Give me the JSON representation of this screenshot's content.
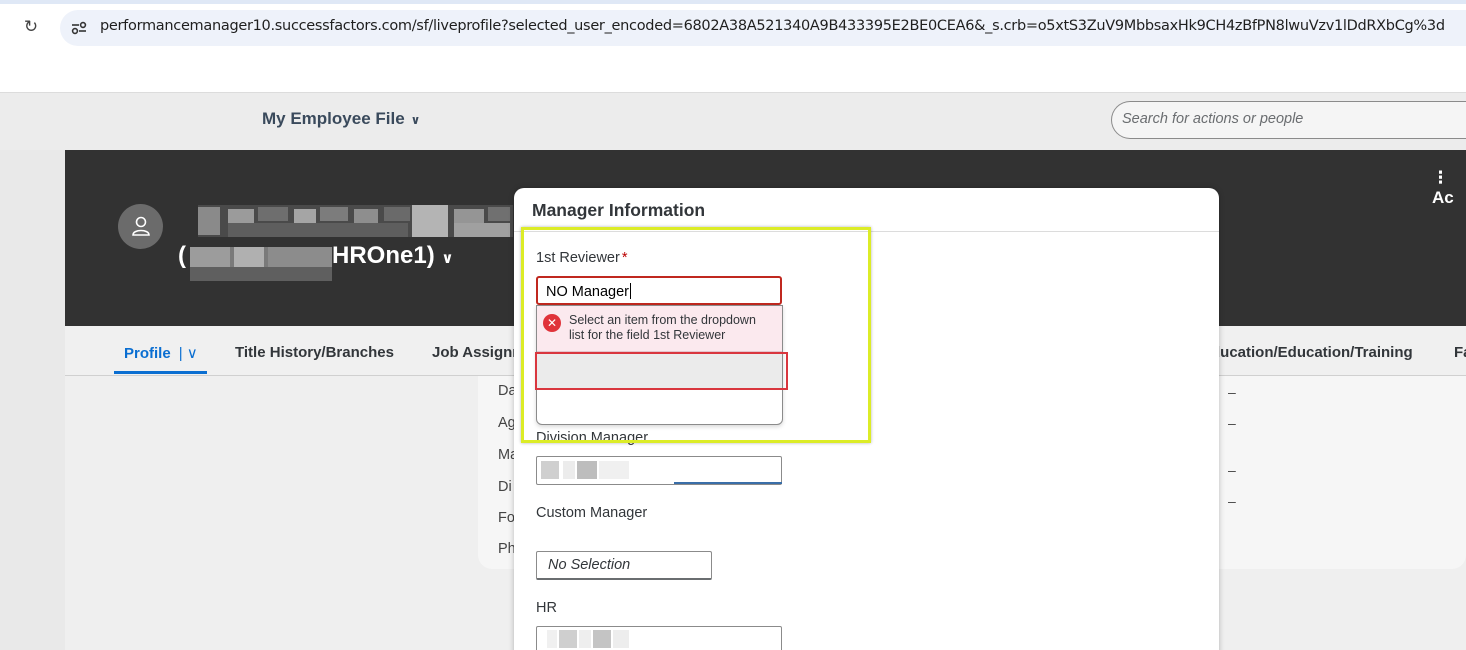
{
  "browser": {
    "url": "performancemanager10.successfactors.com/sf/liveprofile?selected_user_encoded=6802A38A521340A9B433395E2BE0CEA6&_s.crb=o5xtS3ZuV9MbbsaxHk9CH4zBfPN8lwuVzv1lDdRXbCg%3d"
  },
  "shell": {
    "home_title": "My Employee File",
    "search_placeholder": "Search for actions or people"
  },
  "profile": {
    "name_line1_prefix": "(",
    "name_line2": "(",
    "name_line2_suffix": "HROne1)",
    "actions_label": "Ac"
  },
  "tabs": [
    {
      "label": "Profile",
      "active": true
    },
    {
      "label": "Title History/Branches"
    },
    {
      "label": "Job Assignr"
    },
    {
      "label": "ducation/Education/Training"
    },
    {
      "label": "Fa"
    }
  ],
  "card": {
    "labels": [
      "Da",
      "Ag",
      "Ma",
      "Di",
      "Fo",
      "Ph"
    ],
    "dash": "–"
  },
  "dialog": {
    "title": "Manager Information",
    "fields": {
      "first_reviewer": {
        "label": "1st Reviewer",
        "required_mark": "*",
        "value": "NO Manager"
      },
      "division_manager": {
        "label": "Division Manager"
      },
      "custom_manager": {
        "label": "Custom Manager",
        "value": "No Selection"
      },
      "hr": {
        "label": "HR"
      }
    },
    "error_message": "Select an item from the dropdown list for the field 1st Reviewer"
  },
  "colors": {
    "accent": "#0a6ed1",
    "error": "#c0281f",
    "highlight": "#dcec27",
    "header_dark": "#323232"
  }
}
